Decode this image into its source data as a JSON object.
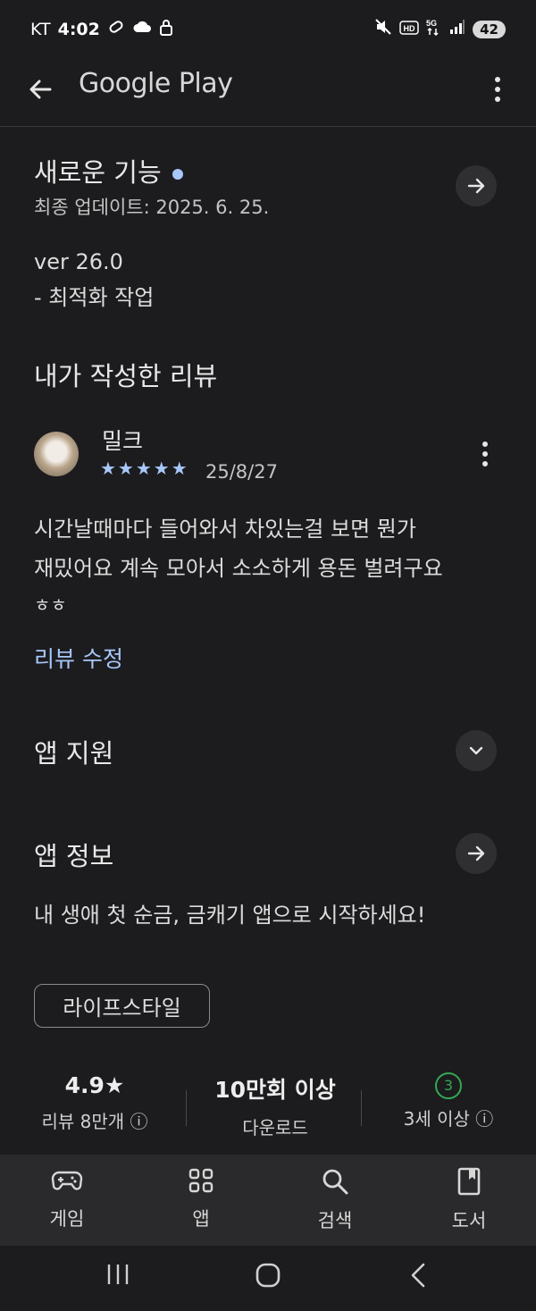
{
  "status_bar": {
    "carrier": "KT",
    "time": "4:02",
    "battery": "42"
  },
  "app_bar": {
    "title": "Google Play"
  },
  "whats_new": {
    "title": "새로운 기능",
    "last_updated": "최종 업데이트: 2025. 6. 25.",
    "version": "ver 26.0",
    "note": "- 최적화 작업"
  },
  "my_review": {
    "title": "내가 작성한 리뷰",
    "reviewer": "밀크",
    "stars": "★★★★★",
    "date": "25/8/27",
    "text_line1": "시간날때마다 들어와서 차있는걸 보면 뭔가",
    "text_line2": "재밌어요 계속 모아서 소소하게 용돈 벌려구요",
    "text_line3": "ㅎㅎ",
    "edit_link": "리뷰 수정"
  },
  "app_support": {
    "title": "앱 지원"
  },
  "app_info": {
    "title": "앱 정보",
    "description": "내 생애 첫 순금, 금캐기 앱으로 시작하세요!",
    "category_chip": "라이프스타일"
  },
  "stats": {
    "rating": "4.9★",
    "reviews": "리뷰 8만개 ⓘ",
    "downloads": "10만회 이상",
    "downloads_label": "다운로드",
    "age_badge": "3",
    "age_label": "3세 이상 ⓘ"
  },
  "bottom_nav": [
    {
      "label": "게임",
      "icon": "gamepad-icon"
    },
    {
      "label": "앱",
      "icon": "apps-grid-icon"
    },
    {
      "label": "검색",
      "icon": "search-icon"
    },
    {
      "label": "도서",
      "icon": "book-icon"
    }
  ],
  "colors": {
    "background": "#1c1c1e",
    "accent": "#a8c7fa",
    "age_badge": "#34a853"
  }
}
